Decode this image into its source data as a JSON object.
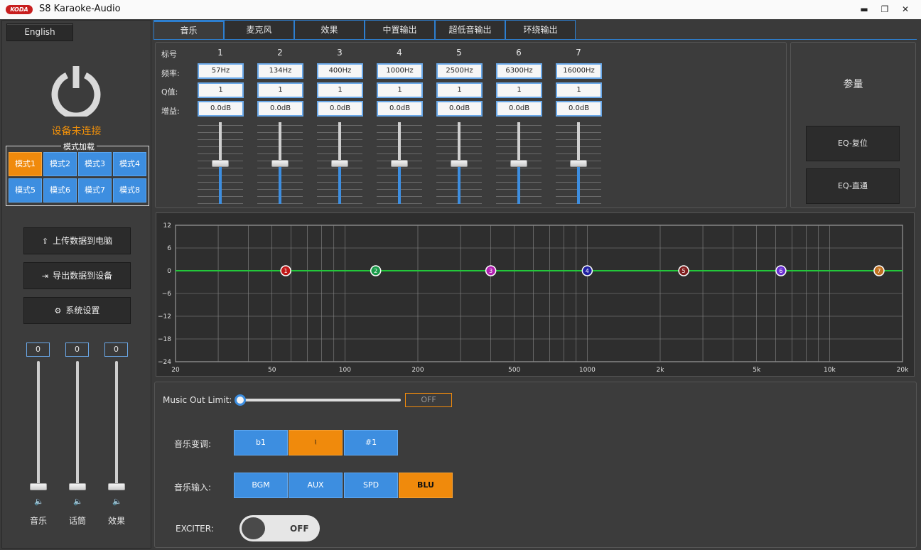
{
  "app": {
    "logo": "KODA",
    "title": "S8 Karaoke-Audio"
  },
  "window": {
    "minimize": "▬",
    "maximize": "❐",
    "close": "✕"
  },
  "left": {
    "language": "English",
    "status": "设备未连接",
    "mode_group": "模式加载",
    "modes": [
      "模式1",
      "模式2",
      "模式3",
      "模式4",
      "模式5",
      "模式6",
      "模式7",
      "模式8"
    ],
    "active_mode": 0,
    "actions": [
      {
        "label": "上传数据到电脑",
        "icon": "upload-icon"
      },
      {
        "label": "导出数据到设备",
        "icon": "export-icon"
      },
      {
        "label": "系统设置",
        "icon": "gear-icon"
      }
    ],
    "volumes": [
      {
        "label": "音乐",
        "value": "0"
      },
      {
        "label": "话筒",
        "value": "0"
      },
      {
        "label": "效果",
        "value": "0"
      }
    ]
  },
  "tabs": [
    "音乐",
    "麦克风",
    "效果",
    "中置输出",
    "超低音输出",
    "环绕输出"
  ],
  "active_tab": 0,
  "eq": {
    "row_labels": {
      "index": "标号",
      "freq": "频率:",
      "q": "Q值:",
      "gain": "增益:"
    },
    "bands": [
      {
        "n": "1",
        "freq": "57Hz",
        "q": "1",
        "gain": "0.0dB"
      },
      {
        "n": "2",
        "freq": "134Hz",
        "q": "1",
        "gain": "0.0dB"
      },
      {
        "n": "3",
        "freq": "400Hz",
        "q": "1",
        "gain": "0.0dB"
      },
      {
        "n": "4",
        "freq": "1000Hz",
        "q": "1",
        "gain": "0.0dB"
      },
      {
        "n": "5",
        "freq": "2500Hz",
        "q": "1",
        "gain": "0.0dB"
      },
      {
        "n": "6",
        "freq": "6300Hz",
        "q": "1",
        "gain": "0.0dB"
      },
      {
        "n": "7",
        "freq": "16000Hz",
        "q": "1",
        "gain": "0.0dB"
      }
    ],
    "param_title": "参量",
    "reset": "EQ-复位",
    "bypass": "EQ-直通"
  },
  "graph": {
    "y_ticks": [
      "12",
      "6",
      "0",
      "−6",
      "−12",
      "−18",
      "−24"
    ],
    "x_ticks": [
      "20",
      "50",
      "100",
      "200",
      "500",
      "1000",
      "2k",
      "5k",
      "10k",
      "20k"
    ],
    "point_colors": [
      "#c01818",
      "#1a9a4a",
      "#b020b0",
      "#2020a0",
      "#802020",
      "#6a30d0",
      "#c07020"
    ]
  },
  "bottom": {
    "limit_label": "Music Out Limit:",
    "limit_state": "OFF",
    "pitch_label": "音乐变调:",
    "pitch": [
      "b1",
      "♮",
      "#1"
    ],
    "pitch_active": 1,
    "input_label": "音乐输入:",
    "inputs": [
      "BGM",
      "AUX",
      "SPD",
      "BLU"
    ],
    "input_active": 3,
    "exciter_label": "EXCITER:",
    "exciter_state": "OFF"
  }
}
